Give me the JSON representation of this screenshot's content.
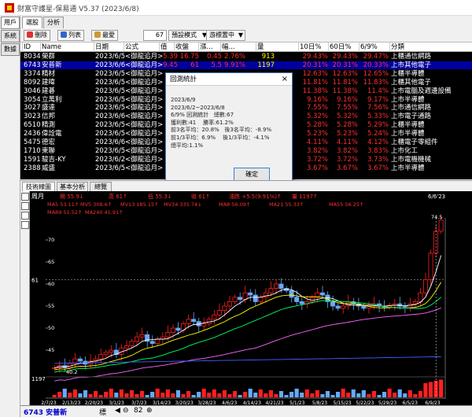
{
  "window": {
    "title": "財富守護星-保易通 V5.37 (2023/6/8)"
  },
  "left_tabs": [
    {
      "label": "用戶",
      "active": true
    },
    {
      "label": "系統",
      "active": false
    },
    {
      "label": "數據",
      "active": false
    }
  ],
  "top_tabs": [
    {
      "label": "選股",
      "active": true
    },
    {
      "label": "分析",
      "active": false
    }
  ],
  "toolbar": {
    "delete": "刪除",
    "list": "列表",
    "favorite": "最愛",
    "count": "67",
    "mode": "預設模式",
    "position": "游標置中",
    "mode_arrow": "▼",
    "position_arrow": "▼"
  },
  "table": {
    "headers": [
      "ID",
      "Name",
      "日期",
      "公式",
      "值",
      "收盤",
      "漲...",
      "幅...",
      "量",
      "10日%",
      "60日%",
      "6/9%",
      "分類"
    ],
    "rows": [
      [
        "8034",
        "榮群",
        "2023/6/5",
        "<御龍追月>",
        "5.39",
        "16.75",
        "0.45",
        "2.76%",
        "913",
        "29.43%",
        "29.43%",
        "29.47%",
        "上櫃通信網路"
      ],
      [
        "6743",
        "安普新",
        "2023/6/6",
        "<御龍追月>",
        "9.45",
        "61",
        "5.5",
        "9.91%",
        "1197",
        "20.31%",
        "20.31%",
        "20.33%",
        "上市其他電子"
      ],
      [
        "3374",
        "精材",
        "2023/6/5",
        "<御龍追月>",
        "",
        "",
        "",
        "",
        "",
        "12.63%",
        "12.63%",
        "12.65%",
        "上櫃半導體"
      ],
      [
        "8092",
        "建暐",
        "2023/6/5",
        "<御龍追月>",
        "",
        "",
        "",
        "",
        "",
        "11.81%",
        "11.81%",
        "11.83%",
        "上櫃其他電子"
      ],
      [
        "3046",
        "建碁",
        "2023/6/5",
        "<御龍追月>",
        "",
        "",
        "",
        "",
        "",
        "11.38%",
        "11.38%",
        "11.4%",
        "上市電腦及週邊設備"
      ],
      [
        "3054",
        "立萬利",
        "2023/6/5",
        "<御龍追月>",
        "",
        "",
        "",
        "",
        "",
        "9.16%",
        "9.16%",
        "9.17%",
        "上市半導體"
      ],
      [
        "3027",
        "盛達",
        "2023/6/5",
        "<御龍追月>",
        "",
        "",
        "",
        "",
        "",
        "7.55%",
        "7.55%",
        "7.56%",
        "上市通信網路"
      ],
      [
        "3023",
        "信邦",
        "2023/6/6",
        "<御龍追月>",
        "",
        "",
        "",
        "",
        "",
        "5.32%",
        "5.32%",
        "5.33%",
        "上市電子通路"
      ],
      [
        "6510",
        "精測",
        "2023/6/5",
        "<御龍追月>",
        "",
        "",
        "",
        "",
        "",
        "5.28%",
        "5.28%",
        "5.29%",
        "上櫃半導體"
      ],
      [
        "2436",
        "偉詮電",
        "2023/6/5",
        "<御龍追月>",
        "",
        "",
        "",
        "",
        "",
        "5.23%",
        "5.23%",
        "5.24%",
        "上市半導體"
      ],
      [
        "5475",
        "德宏",
        "2023/6/6",
        "<御龍追月>",
        "",
        "",
        "",
        "",
        "",
        "4.11%",
        "4.11%",
        "4.12%",
        "上櫃電子零組件"
      ],
      [
        "1710",
        "東聯",
        "2023/6/5",
        "<御龍追月>",
        "",
        "",
        "",
        "",
        "",
        "3.82%",
        "3.82%",
        "3.83%",
        "上市化工"
      ],
      [
        "1591",
        "駿吉-KY",
        "2023/6/2",
        "<御龍追月>",
        "",
        "",
        "",
        "",
        "",
        "3.72%",
        "3.72%",
        "3.73%",
        "上市電機機械"
      ],
      [
        "2388",
        "威盛",
        "2023/6/5",
        "<御龍追月>",
        "",
        "",
        "",
        "",
        "",
        "3.67%",
        "3.67%",
        "3.67%",
        "上市半導體"
      ]
    ]
  },
  "chart_tabs": [
    "技術線圖",
    "基本分析",
    "總覽"
  ],
  "chart": {
    "period": "周月",
    "info_row1": [
      "開 55.9↓",
      "高 61↑",
      "低 55.3↓",
      "收 61↑",
      "漲跌 +5.5(9.91%)↑",
      "量 1197↑"
    ],
    "info_row2": [
      "MA5 53.11↑",
      "MV5 308.6↑",
      "MV13 185.15↑",
      "MV34 335.74↓",
      "MA8 56.09↑",
      "MA21 55.33↑",
      "MA55 56.25↑"
    ],
    "info_row3": [
      "MA89 51.52↑",
      "MA240 41.91↑"
    ],
    "price_label": "61",
    "vol_label": "1197",
    "hi_label": "74.5",
    "lo_label": "40.2",
    "last_date": "6/6'23",
    "y_ticks": [
      "70",
      "65",
      "60",
      "55",
      "50",
      "45"
    ],
    "x_dates": [
      "2/7/23",
      "2/13/23",
      "2/20/23",
      "3/1/23",
      "3/7/23",
      "3/14/23",
      "3/20/23",
      "3/28/23",
      "4/6/23",
      "4/14/23",
      "4/21/23",
      "5/1/23",
      "5/8/23",
      "5/15/23",
      "5/22/23",
      "5/29/23",
      "6/5/23",
      "6/9/23"
    ],
    "colors": {
      "up": "#ff2020",
      "down": "#4080ff",
      "bg": "#000000"
    }
  },
  "chart_data": {
    "type": "line",
    "title": "6743 安普新",
    "series": [
      {
        "name": "收盤",
        "values": [
          41,
          41.5,
          42,
          43,
          45,
          48,
          47,
          50,
          52,
          55,
          56,
          55,
          54,
          57,
          56,
          55,
          55,
          61
        ]
      }
    ],
    "x": [
      "2/7/23",
      "2/13/23",
      "2/20/23",
      "3/1/23",
      "3/7/23",
      "3/14/23",
      "3/20/23",
      "3/28/23",
      "4/6/23",
      "4/14/23",
      "4/21/23",
      "5/1/23",
      "5/8/23",
      "5/15/23",
      "5/22/23",
      "5/29/23",
      "6/5/23",
      "6/9/23"
    ],
    "ylim": [
      40,
      75
    ]
  },
  "bottom": {
    "symbol": "6743 安普新",
    "mark": "標",
    "zoom": "82"
  },
  "dialog": {
    "title": "回測統計",
    "close": "×",
    "body": "2023/6/9\n2023/6/2~2023/6/8\n6/9% 回測統計   總數:67\n獲利數:41    勝率:61.2%\n前3名平均：20.8%   後3名平均：-8.9%\n前1/3平均：6.9%    後1/3平均：-4.1%\n總平均:1.1%",
    "ok": "確定"
  }
}
